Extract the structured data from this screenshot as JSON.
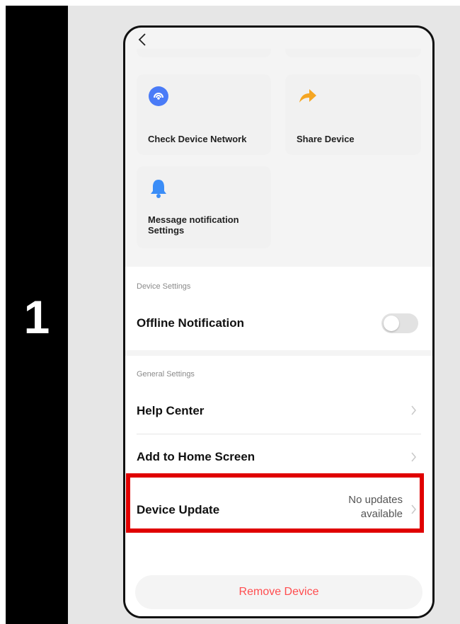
{
  "step": {
    "number": "1"
  },
  "quick_actions": [
    {
      "label": "Check Device Network",
      "icon": "network-icon"
    },
    {
      "label": "Share Device",
      "icon": "share-arrow-icon"
    },
    {
      "label_line1": "Message notification",
      "label_line2": "Settings",
      "icon": "bell-icon"
    }
  ],
  "device_settings": {
    "header": "Device Settings",
    "offline_notification": {
      "label": "Offline Notification",
      "enabled": false
    }
  },
  "general_settings": {
    "header": "General Settings",
    "help_center": "Help Center",
    "add_home_screen": "Add to Home Screen",
    "device_update": {
      "label": "Device Update",
      "status_line1": "No updates",
      "status_line2": "available"
    }
  },
  "remove_device": "Remove Device",
  "colors": {
    "highlight": "#e00000",
    "remove_text": "#ff4d4f",
    "network_icon": "#4a7bf7",
    "share_icon": "#f5a623",
    "bell_icon": "#3b8df7"
  }
}
